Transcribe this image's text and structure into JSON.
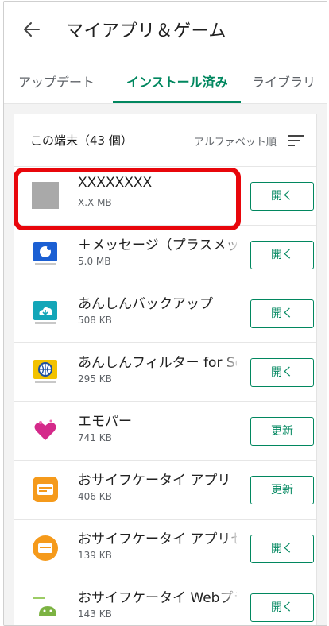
{
  "header": {
    "title": "マイアプリ＆ゲーム",
    "back_icon": "back-arrow-icon"
  },
  "tabs": [
    {
      "label": "アップデート",
      "active": false
    },
    {
      "label": "インストール済み",
      "active": true
    },
    {
      "label": "ライブラリ",
      "active": false
    }
  ],
  "section": {
    "title": "この端末（43 個）",
    "sort_label": "アルファベット順",
    "sort_icon": "sort-icon"
  },
  "apps": [
    {
      "name": "XXXXXXXX",
      "size": "X.X MB",
      "button": "開く",
      "icon": "placeholder-gray-icon"
    },
    {
      "name": "＋メッセージ（プラスメッセ",
      "size": "5.0 MB",
      "button": "開く",
      "icon": "plus-message-icon"
    },
    {
      "name": "あんしんバックアップ",
      "size": "508 KB",
      "button": "開く",
      "icon": "backup-cloud-icon"
    },
    {
      "name": "あんしんフィルター for SoftBank",
      "size": "295 KB",
      "button": "開く",
      "icon": "filter-globe-icon"
    },
    {
      "name": "エモパー",
      "size": "741 KB",
      "button": "更新",
      "icon": "emopa-heart-icon"
    },
    {
      "name": "おサイフケータイ アプリ",
      "size": "406 KB",
      "button": "更新",
      "icon": "osaifu-keitai-icon"
    },
    {
      "name": "おサイフケータイ アプリセ",
      "size": "139 KB",
      "button": "開く",
      "icon": "osaifu-keitai-settings-icon"
    },
    {
      "name": "おサイフケータイ Webプラ",
      "size": "143 KB",
      "button": "開く",
      "icon": "android-web-plugin-icon"
    }
  ],
  "colors": {
    "accent": "#01875f",
    "highlight": "#e8060b"
  }
}
